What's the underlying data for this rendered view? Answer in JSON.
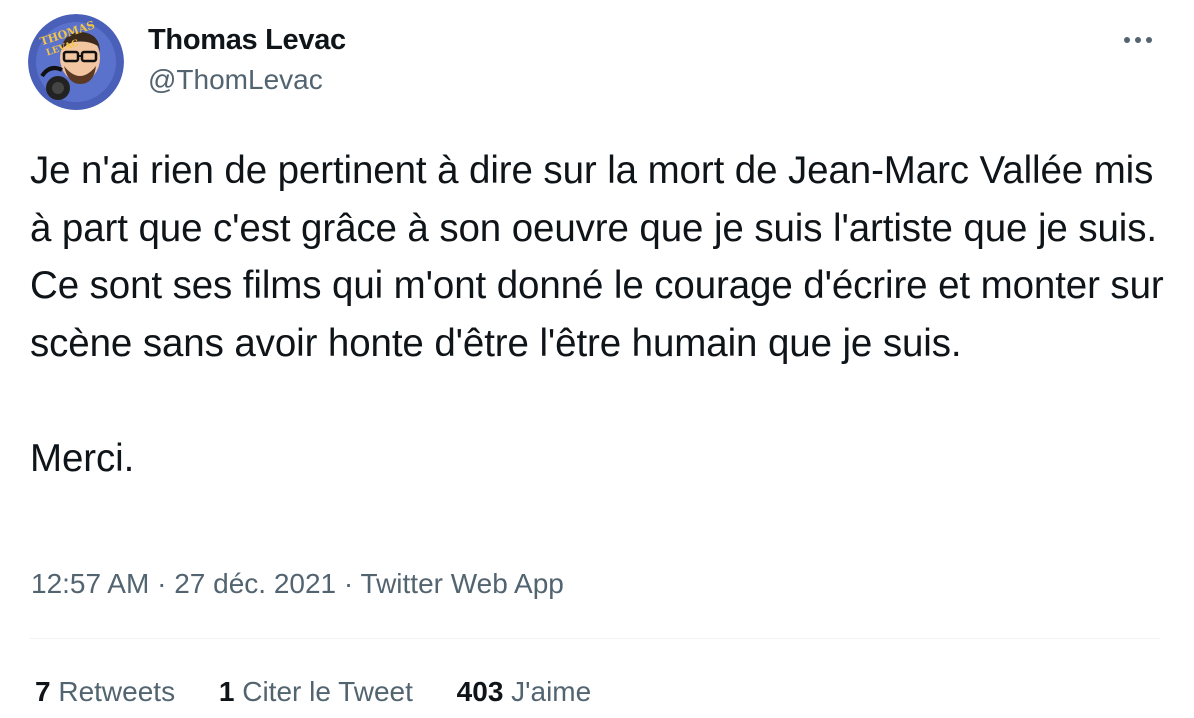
{
  "author": {
    "name": "Thomas Levac",
    "handle": "@ThomLevac",
    "avatar_text": "THOMAS LEVAC"
  },
  "more_icon": "ellipsis-icon",
  "tweet": {
    "paragraphs": [
      "Je n'ai rien de pertinent à dire sur la mort de Jean-Marc Vallée mis à part que c'est grâce à son oeuvre que je suis l'artiste que je suis. Ce sont ses films qui m'ont donné le courage d'écrire et monter sur scène sans avoir honte d'être l'être humain que je suis.",
      "Merci."
    ]
  },
  "meta": {
    "time": "12:57 AM",
    "separator": "·",
    "date": "27 déc. 2021",
    "source": "Twitter Web App"
  },
  "stats": [
    {
      "count": "7",
      "label": "Retweets"
    },
    {
      "count": "1",
      "label": "Citer le Tweet"
    },
    {
      "count": "403",
      "label": "J'aime"
    }
  ],
  "colors": {
    "text_primary": "#0f1419",
    "text_secondary": "#536471",
    "divider": "#eff3f4",
    "avatar_bg": "#4a5fb8"
  }
}
